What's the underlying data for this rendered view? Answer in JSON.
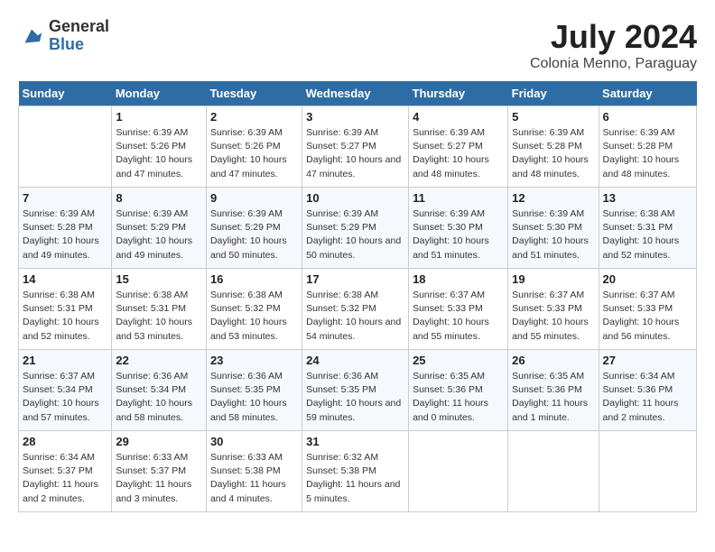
{
  "header": {
    "logo_line1": "General",
    "logo_line2": "Blue",
    "title": "July 2024",
    "subtitle": "Colonia Menno, Paraguay"
  },
  "columns": [
    "Sunday",
    "Monday",
    "Tuesday",
    "Wednesday",
    "Thursday",
    "Friday",
    "Saturday"
  ],
  "weeks": [
    [
      {
        "day": "",
        "sunrise": "",
        "sunset": "",
        "daylight": ""
      },
      {
        "day": "1",
        "sunrise": "Sunrise: 6:39 AM",
        "sunset": "Sunset: 5:26 PM",
        "daylight": "Daylight: 10 hours and 47 minutes."
      },
      {
        "day": "2",
        "sunrise": "Sunrise: 6:39 AM",
        "sunset": "Sunset: 5:26 PM",
        "daylight": "Daylight: 10 hours and 47 minutes."
      },
      {
        "day": "3",
        "sunrise": "Sunrise: 6:39 AM",
        "sunset": "Sunset: 5:27 PM",
        "daylight": "Daylight: 10 hours and 47 minutes."
      },
      {
        "day": "4",
        "sunrise": "Sunrise: 6:39 AM",
        "sunset": "Sunset: 5:27 PM",
        "daylight": "Daylight: 10 hours and 48 minutes."
      },
      {
        "day": "5",
        "sunrise": "Sunrise: 6:39 AM",
        "sunset": "Sunset: 5:28 PM",
        "daylight": "Daylight: 10 hours and 48 minutes."
      },
      {
        "day": "6",
        "sunrise": "Sunrise: 6:39 AM",
        "sunset": "Sunset: 5:28 PM",
        "daylight": "Daylight: 10 hours and 48 minutes."
      }
    ],
    [
      {
        "day": "7",
        "sunrise": "Sunrise: 6:39 AM",
        "sunset": "Sunset: 5:28 PM",
        "daylight": "Daylight: 10 hours and 49 minutes."
      },
      {
        "day": "8",
        "sunrise": "Sunrise: 6:39 AM",
        "sunset": "Sunset: 5:29 PM",
        "daylight": "Daylight: 10 hours and 49 minutes."
      },
      {
        "day": "9",
        "sunrise": "Sunrise: 6:39 AM",
        "sunset": "Sunset: 5:29 PM",
        "daylight": "Daylight: 10 hours and 50 minutes."
      },
      {
        "day": "10",
        "sunrise": "Sunrise: 6:39 AM",
        "sunset": "Sunset: 5:29 PM",
        "daylight": "Daylight: 10 hours and 50 minutes."
      },
      {
        "day": "11",
        "sunrise": "Sunrise: 6:39 AM",
        "sunset": "Sunset: 5:30 PM",
        "daylight": "Daylight: 10 hours and 51 minutes."
      },
      {
        "day": "12",
        "sunrise": "Sunrise: 6:39 AM",
        "sunset": "Sunset: 5:30 PM",
        "daylight": "Daylight: 10 hours and 51 minutes."
      },
      {
        "day": "13",
        "sunrise": "Sunrise: 6:38 AM",
        "sunset": "Sunset: 5:31 PM",
        "daylight": "Daylight: 10 hours and 52 minutes."
      }
    ],
    [
      {
        "day": "14",
        "sunrise": "Sunrise: 6:38 AM",
        "sunset": "Sunset: 5:31 PM",
        "daylight": "Daylight: 10 hours and 52 minutes."
      },
      {
        "day": "15",
        "sunrise": "Sunrise: 6:38 AM",
        "sunset": "Sunset: 5:31 PM",
        "daylight": "Daylight: 10 hours and 53 minutes."
      },
      {
        "day": "16",
        "sunrise": "Sunrise: 6:38 AM",
        "sunset": "Sunset: 5:32 PM",
        "daylight": "Daylight: 10 hours and 53 minutes."
      },
      {
        "day": "17",
        "sunrise": "Sunrise: 6:38 AM",
        "sunset": "Sunset: 5:32 PM",
        "daylight": "Daylight: 10 hours and 54 minutes."
      },
      {
        "day": "18",
        "sunrise": "Sunrise: 6:37 AM",
        "sunset": "Sunset: 5:33 PM",
        "daylight": "Daylight: 10 hours and 55 minutes."
      },
      {
        "day": "19",
        "sunrise": "Sunrise: 6:37 AM",
        "sunset": "Sunset: 5:33 PM",
        "daylight": "Daylight: 10 hours and 55 minutes."
      },
      {
        "day": "20",
        "sunrise": "Sunrise: 6:37 AM",
        "sunset": "Sunset: 5:33 PM",
        "daylight": "Daylight: 10 hours and 56 minutes."
      }
    ],
    [
      {
        "day": "21",
        "sunrise": "Sunrise: 6:37 AM",
        "sunset": "Sunset: 5:34 PM",
        "daylight": "Daylight: 10 hours and 57 minutes."
      },
      {
        "day": "22",
        "sunrise": "Sunrise: 6:36 AM",
        "sunset": "Sunset: 5:34 PM",
        "daylight": "Daylight: 10 hours and 58 minutes."
      },
      {
        "day": "23",
        "sunrise": "Sunrise: 6:36 AM",
        "sunset": "Sunset: 5:35 PM",
        "daylight": "Daylight: 10 hours and 58 minutes."
      },
      {
        "day": "24",
        "sunrise": "Sunrise: 6:36 AM",
        "sunset": "Sunset: 5:35 PM",
        "daylight": "Daylight: 10 hours and 59 minutes."
      },
      {
        "day": "25",
        "sunrise": "Sunrise: 6:35 AM",
        "sunset": "Sunset: 5:36 PM",
        "daylight": "Daylight: 11 hours and 0 minutes."
      },
      {
        "day": "26",
        "sunrise": "Sunrise: 6:35 AM",
        "sunset": "Sunset: 5:36 PM",
        "daylight": "Daylight: 11 hours and 1 minute."
      },
      {
        "day": "27",
        "sunrise": "Sunrise: 6:34 AM",
        "sunset": "Sunset: 5:36 PM",
        "daylight": "Daylight: 11 hours and 2 minutes."
      }
    ],
    [
      {
        "day": "28",
        "sunrise": "Sunrise: 6:34 AM",
        "sunset": "Sunset: 5:37 PM",
        "daylight": "Daylight: 11 hours and 2 minutes."
      },
      {
        "day": "29",
        "sunrise": "Sunrise: 6:33 AM",
        "sunset": "Sunset: 5:37 PM",
        "daylight": "Daylight: 11 hours and 3 minutes."
      },
      {
        "day": "30",
        "sunrise": "Sunrise: 6:33 AM",
        "sunset": "Sunset: 5:38 PM",
        "daylight": "Daylight: 11 hours and 4 minutes."
      },
      {
        "day": "31",
        "sunrise": "Sunrise: 6:32 AM",
        "sunset": "Sunset: 5:38 PM",
        "daylight": "Daylight: 11 hours and 5 minutes."
      },
      {
        "day": "",
        "sunrise": "",
        "sunset": "",
        "daylight": ""
      },
      {
        "day": "",
        "sunrise": "",
        "sunset": "",
        "daylight": ""
      },
      {
        "day": "",
        "sunrise": "",
        "sunset": "",
        "daylight": ""
      }
    ]
  ]
}
